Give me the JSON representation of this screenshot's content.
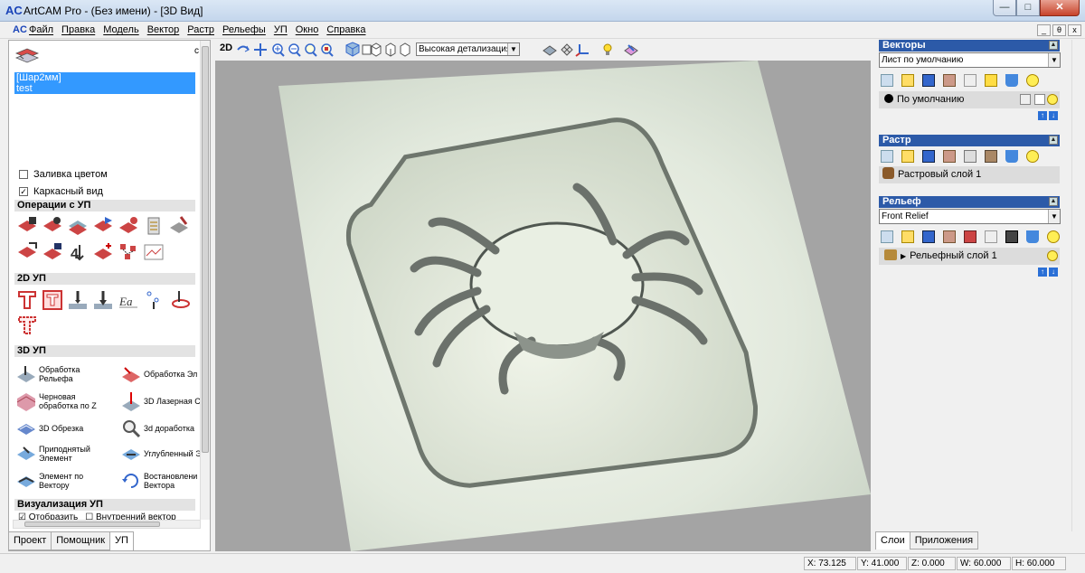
{
  "window": {
    "title": "ArtCAM Pro - (Без имени) - [3D Вид]",
    "app_logo": "AC",
    "min_label": "—",
    "max_label": "□",
    "close_label": "✕"
  },
  "menu": [
    "Файл",
    "Правка",
    "Модель",
    "Вектор",
    "Растр",
    "Рельефы",
    "УП",
    "Окно",
    "Справка"
  ],
  "mdi_controls": [
    "_",
    "θ",
    "x"
  ],
  "left": {
    "toolpaths": [
      "[Шар2мм]",
      "test"
    ],
    "color_fill": "Заливка цветом",
    "wireframe": "Каркасный вид",
    "wireframe_checked": true,
    "color_fill_checked": false,
    "sec_ops": "Операции с УП",
    "sec_2d": "2D УП",
    "sec_3d": "3D УП",
    "sec_vis": "Визуализация УП",
    "tools3d": [
      "Обработка Рельефа",
      "Обработка Эл",
      "Черновая обработка по Z",
      "3D Лазерная С",
      "3D Обрезка",
      "3d доработка",
      "Приподнятый Элемент",
      "Углубленный Э",
      "Элемент по Вектору",
      "Востановлени Вектора"
    ],
    "vis_cut": "Отобразить",
    "vis_inner": "Внутренний вектор",
    "tabs": [
      "Проект",
      "Помощник",
      "УП"
    ],
    "active_tab": "УП"
  },
  "toolbar": {
    "mode": "2D",
    "detail": "Высокая детализация"
  },
  "right": {
    "vectors_title": "Векторы",
    "vectors_sheet": "Лист по умолчанию",
    "vectors_layer": "По умолчанию",
    "raster_title": "Растр",
    "raster_layer": "Растровый слой 1",
    "relief_title": "Рельеф",
    "relief_select": "Front Relief",
    "relief_layer": "Рельефный слой 1",
    "tabs": [
      "Слои",
      "Приложения"
    ],
    "active_tab": "Слои"
  },
  "status": {
    "x": "X: 73.125",
    "y": "Y: 41.000",
    "z": "Z: 0.000",
    "w": "W: 60.000",
    "h": "H: 60.000"
  },
  "colors": {
    "selection": "#3399ff",
    "panel_header": "#2c5aa8",
    "model_face": "#e6ece2",
    "viewport_bg": "#a4a4a4"
  }
}
